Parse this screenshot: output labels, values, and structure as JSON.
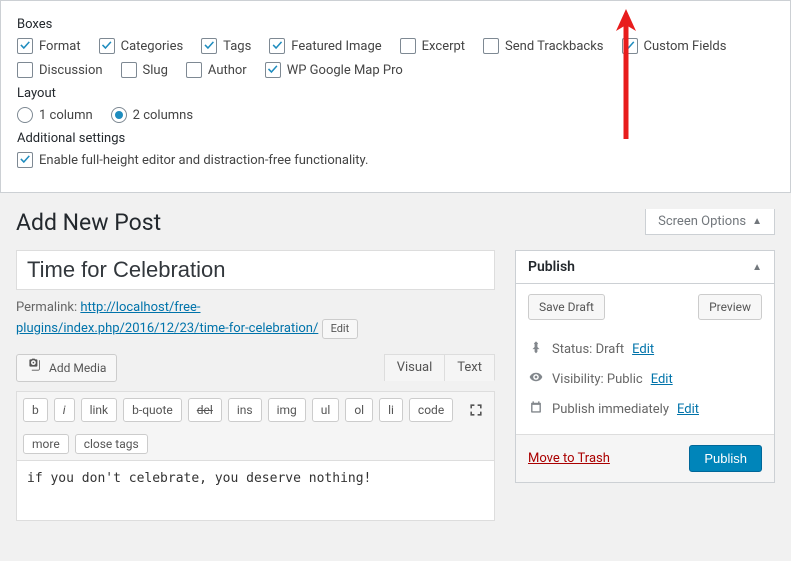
{
  "boxes": {
    "label": "Boxes",
    "items": [
      {
        "label": "Format",
        "checked": true
      },
      {
        "label": "Categories",
        "checked": true
      },
      {
        "label": "Tags",
        "checked": true
      },
      {
        "label": "Featured Image",
        "checked": true
      },
      {
        "label": "Excerpt",
        "checked": false
      },
      {
        "label": "Send Trackbacks",
        "checked": false
      },
      {
        "label": "Custom Fields",
        "checked": true
      },
      {
        "label": "Discussion",
        "checked": false
      },
      {
        "label": "Slug",
        "checked": false
      },
      {
        "label": "Author",
        "checked": false
      },
      {
        "label": "WP Google Map Pro",
        "checked": true
      }
    ]
  },
  "layout": {
    "label": "Layout",
    "options": [
      {
        "label": "1 column",
        "checked": false
      },
      {
        "label": "2 columns",
        "checked": true
      }
    ]
  },
  "additional": {
    "label": "Additional settings",
    "fullheight": {
      "label": "Enable full-height editor and distraction-free functionality.",
      "checked": true
    }
  },
  "screen_options_tab": "Screen Options",
  "page_title": "Add New Post",
  "post_title": "Time for Celebration",
  "permalink": {
    "label": "Permalink:",
    "url_text": "http://localhost/free-plugins/index.php/2016/12/23/time-for-celebration/",
    "edit": "Edit"
  },
  "media": {
    "add_media": "Add Media"
  },
  "editor_tabs": {
    "visual": "Visual",
    "text": "Text"
  },
  "quicktags": [
    "b",
    "i",
    "link",
    "b-quote",
    "del",
    "ins",
    "img",
    "ul",
    "ol",
    "li",
    "code",
    "more",
    "close tags"
  ],
  "editor_content": "if you don't celebrate, you deserve nothing!",
  "publish": {
    "title": "Publish",
    "save_draft": "Save Draft",
    "preview": "Preview",
    "status_label": "Status:",
    "status_value": "Draft",
    "visibility_label": "Visibility:",
    "visibility_value": "Public",
    "schedule_label": "Publish",
    "schedule_value": "immediately",
    "edit": "Edit",
    "trash": "Move to Trash",
    "publish_btn": "Publish"
  },
  "colors": {
    "accent": "#0073aa",
    "primary_btn": "#0085ba",
    "arrow": "#e81c1c"
  }
}
